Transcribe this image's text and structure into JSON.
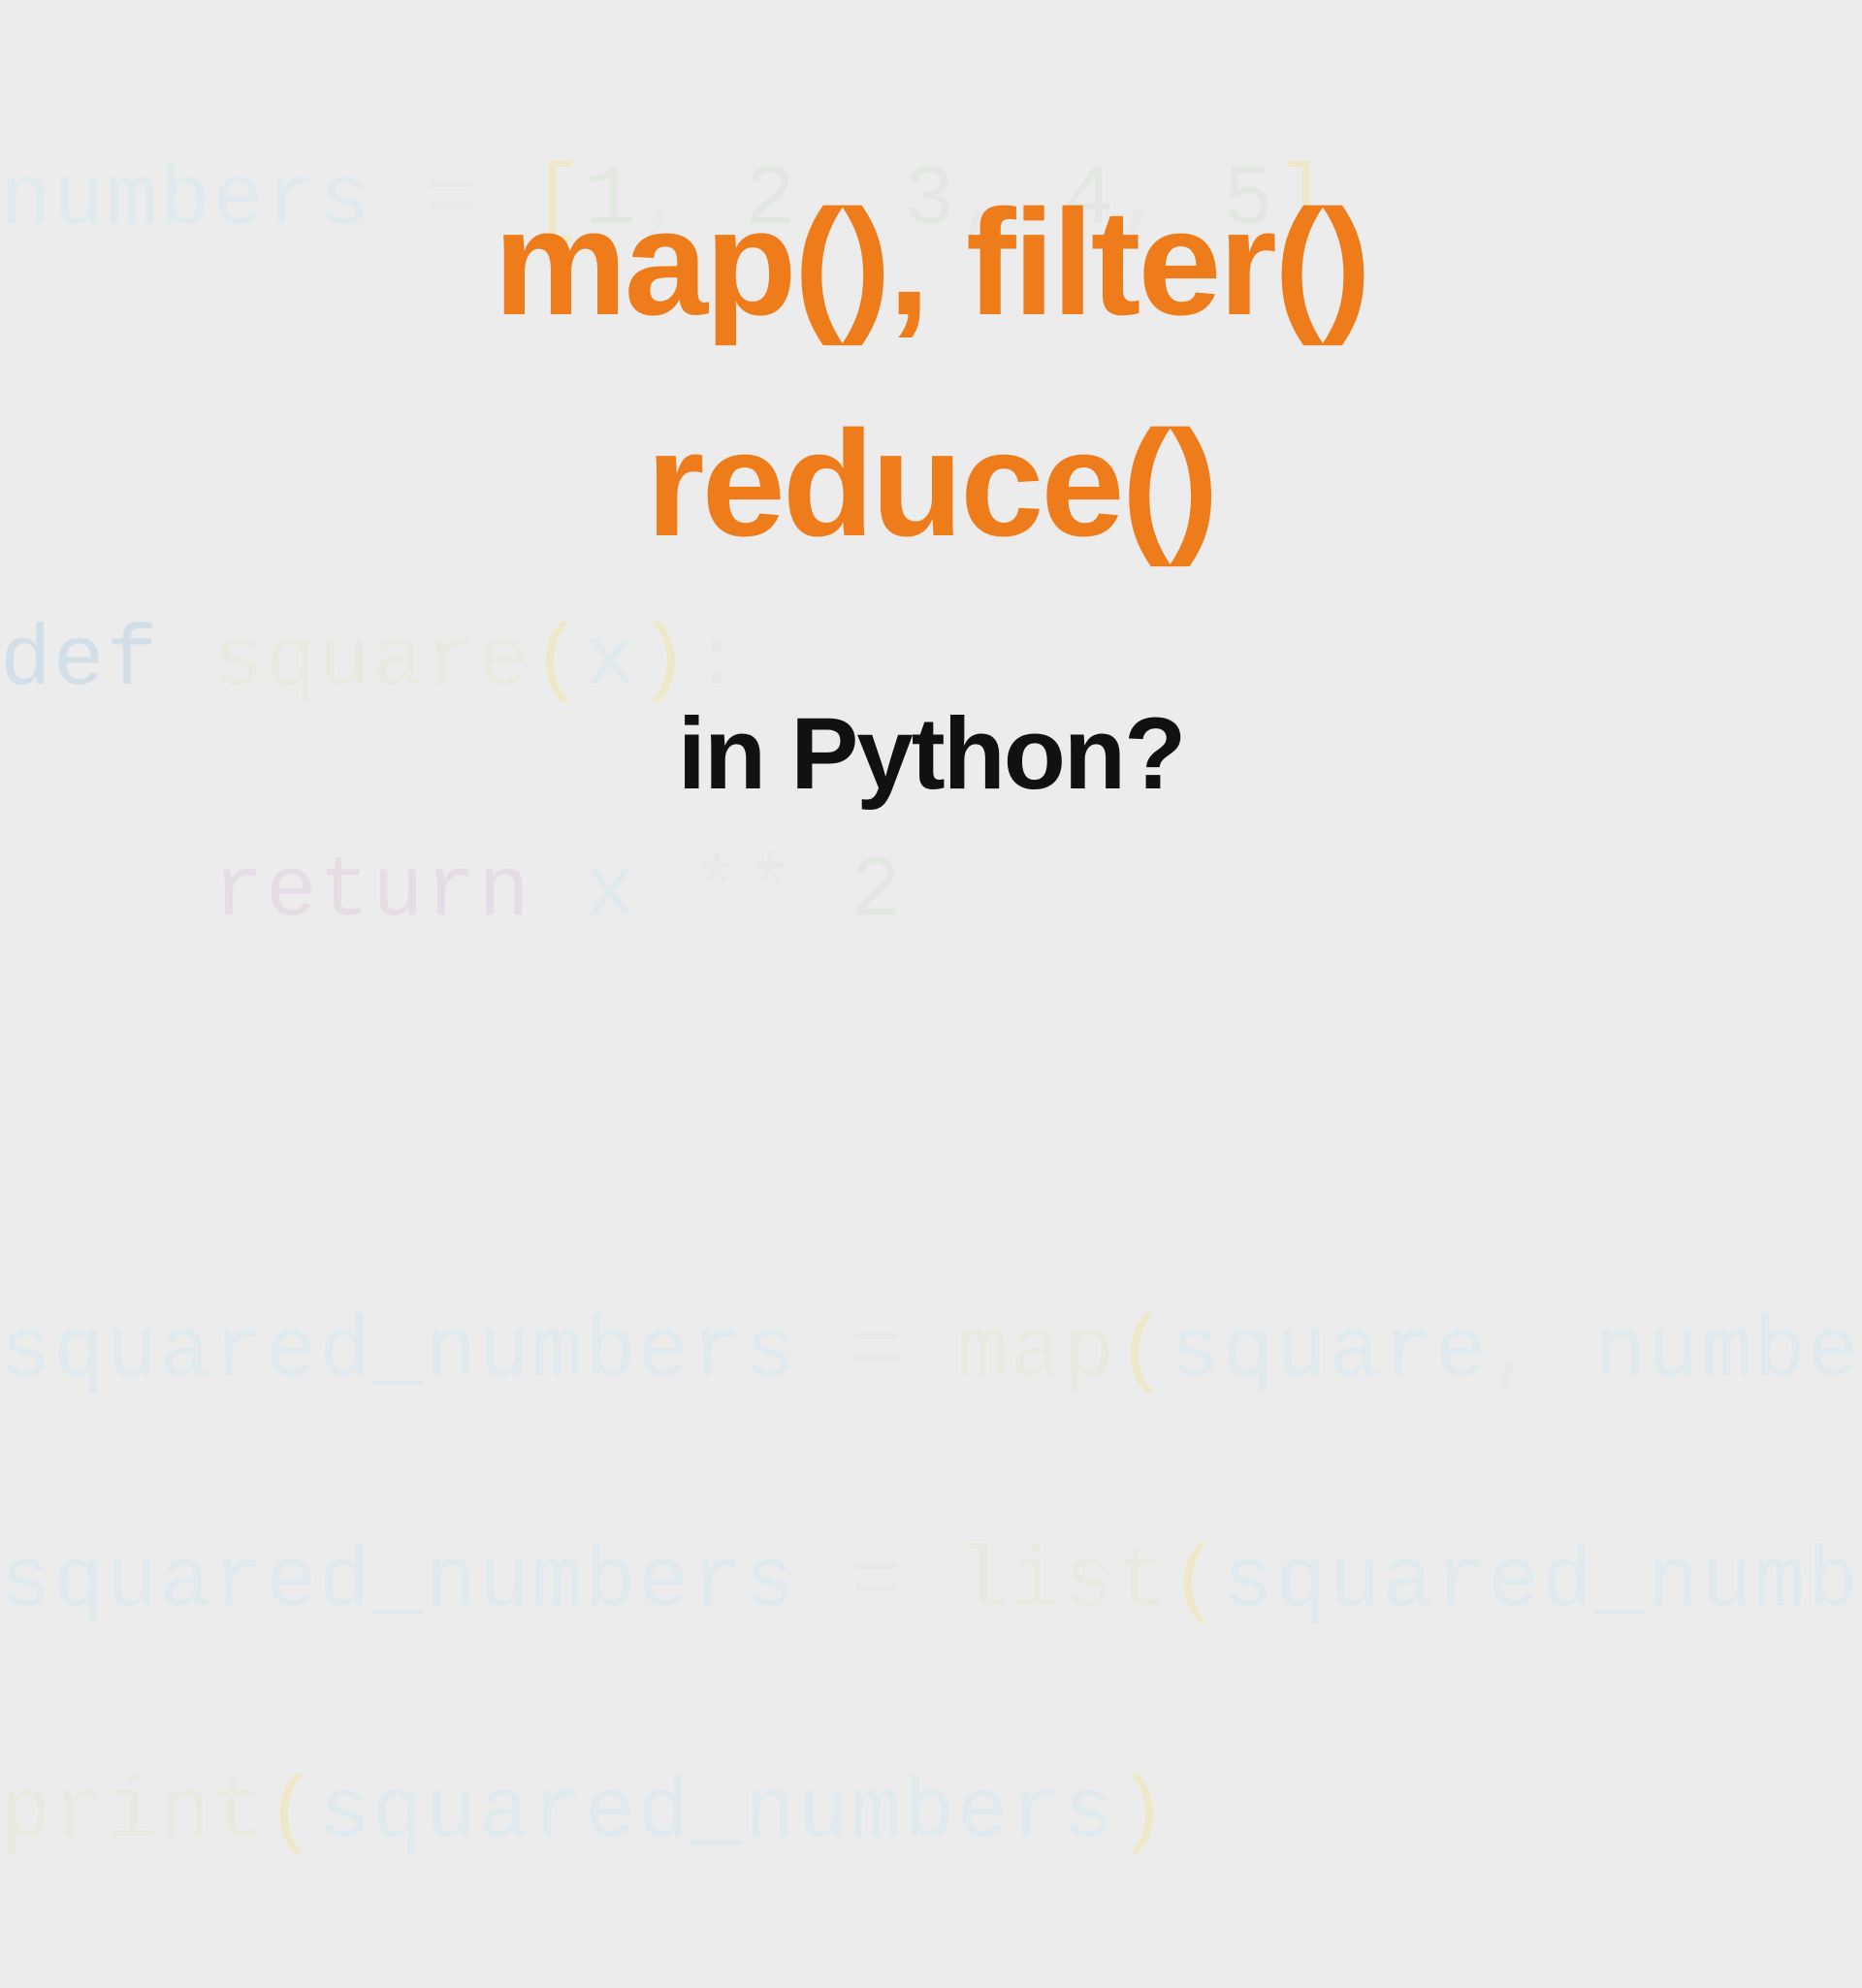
{
  "background_code": {
    "line1_text": "numbers = [1, 2, 3, 4, 5]",
    "line2_text": "",
    "line3_text": "def square(x):",
    "line4_text": "    return x ** 2",
    "line5_text": "",
    "line6_text": "squared_numbers = map(square, numbers)",
    "line7_text": "squared_numbers = list(squared_numbers)",
    "line8_text": "print(squared_numbers)"
  },
  "title": {
    "line1": "map(), filter()",
    "line2": "reduce()"
  },
  "subtitle": "in Python?",
  "colors": {
    "accent_orange": "#ee7c1a",
    "text_dark": "#111111",
    "background": "#ececec"
  }
}
